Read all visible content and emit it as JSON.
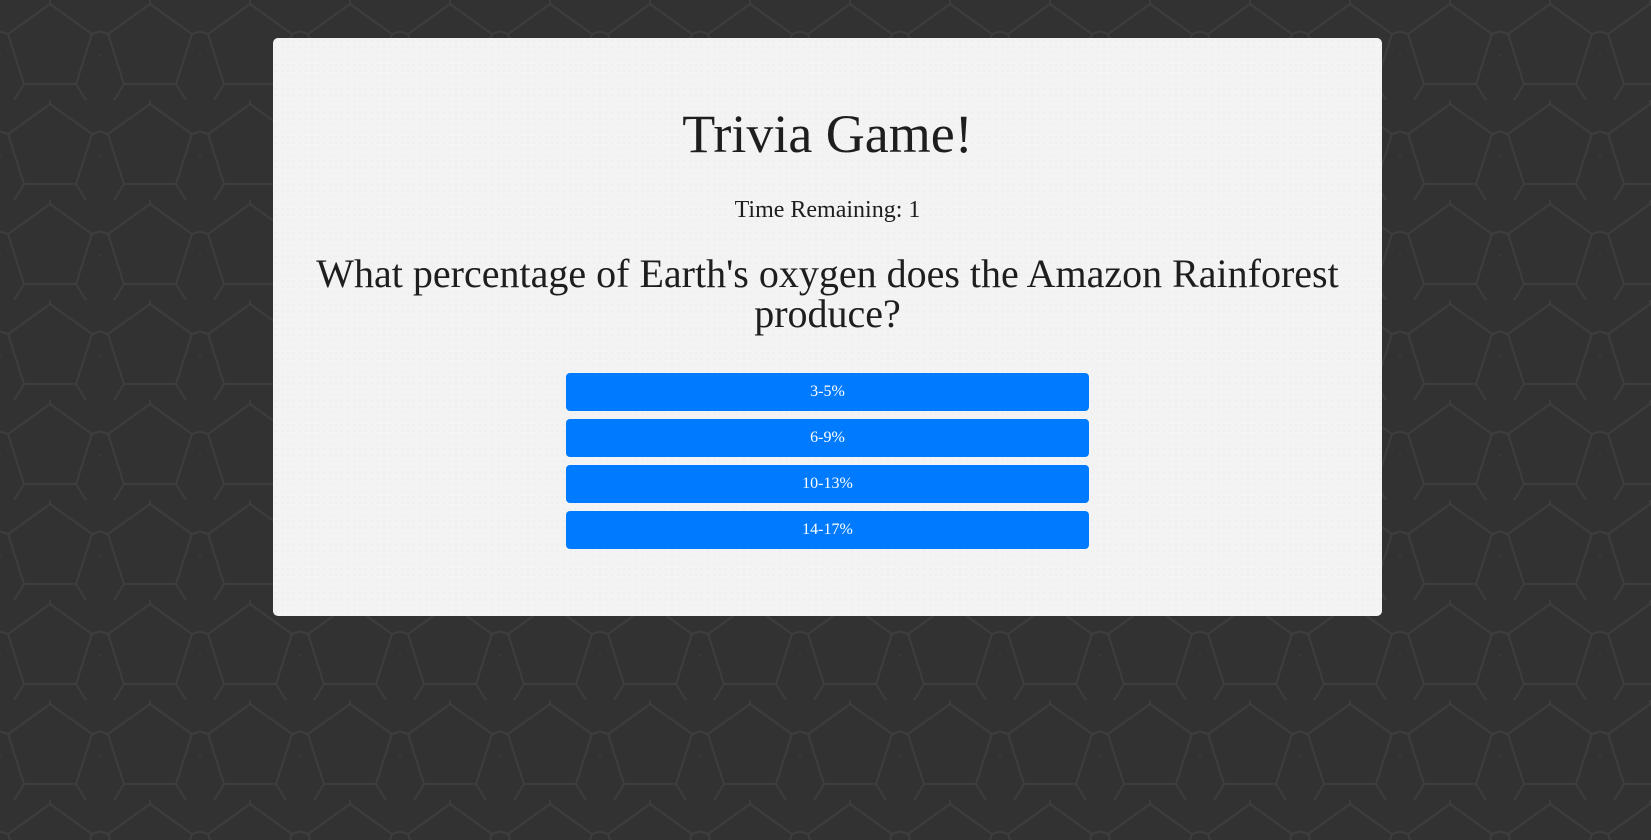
{
  "game": {
    "title": "Trivia Game!",
    "timer_text": "Time Remaining: 1",
    "question": "What percentage of Earth's oxygen does the Amazon Rainforest produce?",
    "answers": [
      "3-5%",
      "6-9%",
      "10-13%",
      "14-17%"
    ]
  },
  "colors": {
    "background": "#323232",
    "card": "#f3f3f3",
    "answer_button": "#007bff",
    "answer_text": "#ffffff",
    "text": "#1e1e1e"
  }
}
